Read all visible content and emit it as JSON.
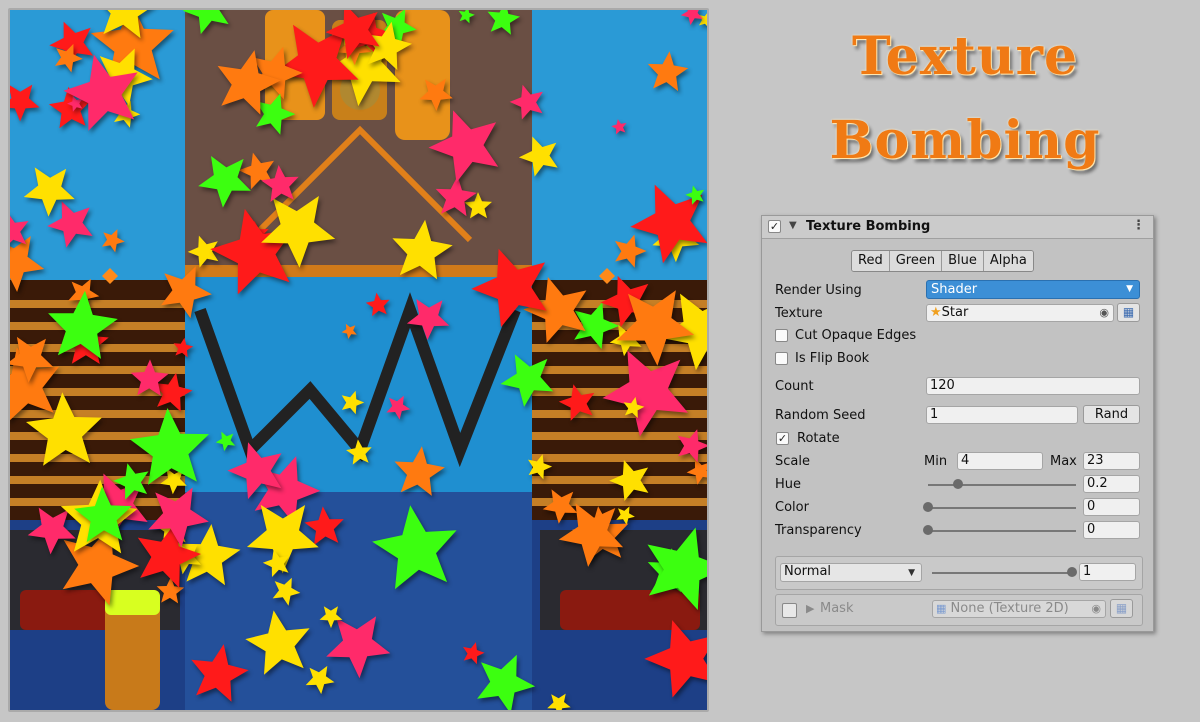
{
  "title": {
    "line1": "Texture",
    "line2": "Bombing"
  },
  "colors": {
    "orange": "#ff7a10",
    "green": "#3cff10",
    "yellow": "#ffe000",
    "red": "#ff1a1a",
    "pink": "#ff2a6a",
    "accent_blue": "#3c8fd6"
  },
  "panel": {
    "header_title": "Texture Bombing",
    "channels": [
      "Red",
      "Green",
      "Blue",
      "Alpha"
    ],
    "render_using": {
      "label": "Render Using",
      "value": "Shader"
    },
    "texture": {
      "label": "Texture",
      "value": "Star"
    },
    "cut_opaque_edges": {
      "label": "Cut Opaque Edges",
      "checked": false
    },
    "is_flip_book": {
      "label": "Is Flip Book",
      "checked": false
    },
    "count": {
      "label": "Count",
      "value": "120"
    },
    "random_seed": {
      "label": "Random Seed",
      "value": "1",
      "button": "Rand"
    },
    "rotate": {
      "label": "Rotate",
      "checked": true
    },
    "scale": {
      "label": "Scale",
      "min_label": "Min",
      "min_value": "4",
      "max_label": "Max",
      "max_value": "23"
    },
    "hue": {
      "label": "Hue",
      "value": "0.2",
      "fraction": 0.2
    },
    "color": {
      "label": "Color",
      "value": "0",
      "fraction": 0
    },
    "transparency": {
      "label": "Transparency",
      "value": "0",
      "fraction": 0
    },
    "blend": {
      "mode": "Normal",
      "value": "1",
      "fraction": 1
    },
    "mask": {
      "label": "Mask",
      "value": "None (Texture 2D)",
      "enabled": false
    }
  }
}
